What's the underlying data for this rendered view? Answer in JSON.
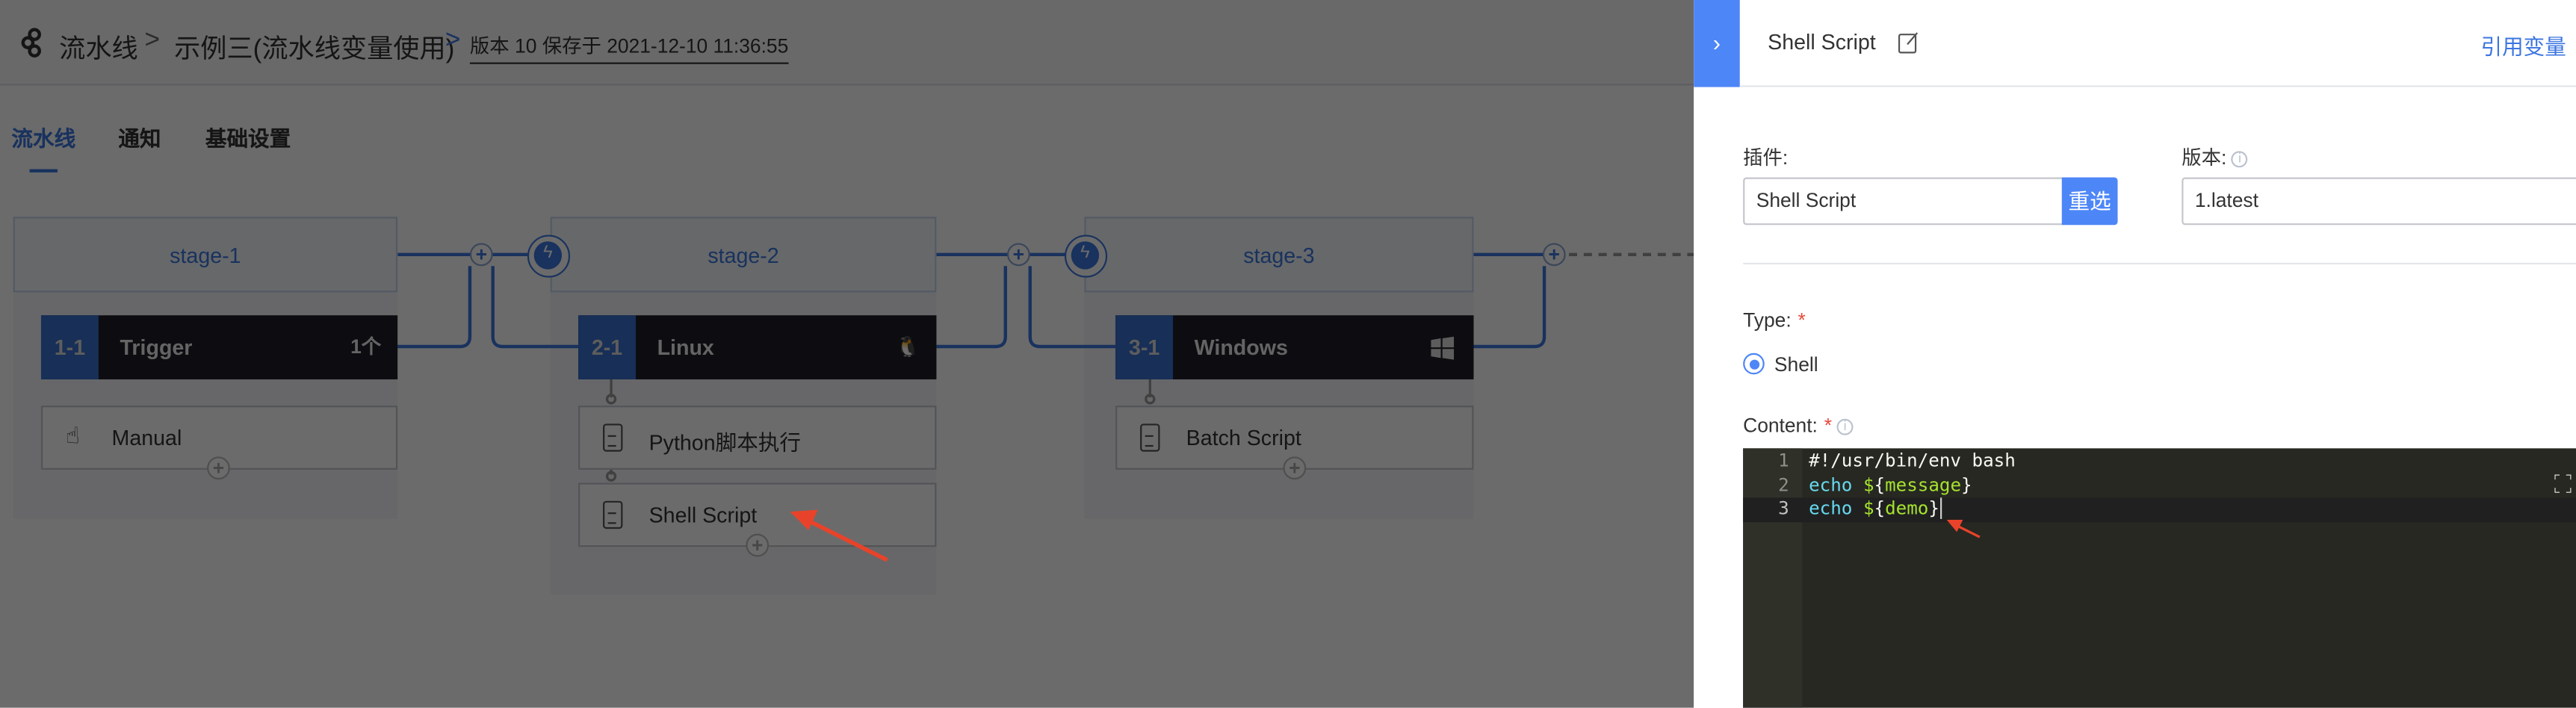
{
  "header": {
    "breadcrumb": [
      "流水线",
      "示例三(流水线变量使用)"
    ],
    "separator": ">",
    "version_info": "版本 10 保存于 2021-12-10 11:36:55"
  },
  "tabs": [
    {
      "label": "流水线",
      "active": true
    },
    {
      "label": "通知"
    },
    {
      "label": "基础设置"
    }
  ],
  "stages": [
    {
      "name": "stage-1",
      "job": {
        "id": "1-1",
        "name": "Trigger",
        "badge": "1个",
        "icon": "hand-up"
      },
      "tasks": [
        {
          "label": "Manual",
          "icon": "hand-pointer-icon"
        }
      ]
    },
    {
      "name": "stage-2",
      "job": {
        "id": "2-1",
        "name": "Linux",
        "icon": "linux-icon"
      },
      "tasks": [
        {
          "label": "Python脚本执行",
          "icon": "clipboard-icon"
        },
        {
          "label": "Shell Script",
          "icon": "clipboard-icon"
        }
      ]
    },
    {
      "name": "stage-3",
      "job": {
        "id": "3-1",
        "name": "Windows",
        "icon": "windows-icon"
      },
      "tasks": [
        {
          "label": "Batch Script",
          "icon": "clipboard-icon"
        }
      ]
    }
  ],
  "panel": {
    "title": "Shell Script",
    "ref_vars": "引用变量",
    "plugin_label": "插件:",
    "plugin_value": "Shell Script",
    "reselect": "重选",
    "version_label": "版本:",
    "version_value": "1.latest",
    "type_label": "Type:",
    "type_option": "Shell",
    "content_label": "Content:",
    "required": "*",
    "code_lines": [
      {
        "no": "1",
        "text": "#!/usr/bin/env bash"
      },
      {
        "no": "2",
        "kw": "echo",
        "var": "message"
      },
      {
        "no": "3",
        "kw": "echo",
        "var": "demo"
      }
    ]
  },
  "colors": {
    "accent": "#3c76e0",
    "button": "#4d86f7",
    "editor_bg": "#272822",
    "annotation_arrow": "#e8432a"
  }
}
